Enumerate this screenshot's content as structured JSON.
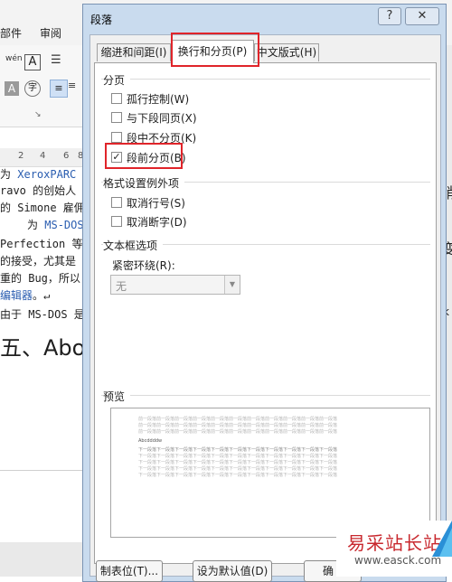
{
  "background": {
    "ribbon": {
      "tab_partial": "部件",
      "tab_review": "审阅",
      "phonetic_icon_text": "wén",
      "char_border_icon_text": "A",
      "shade_icon_text": "A",
      "circle_char_text": "字"
    },
    "ruler_ticks": [
      "2",
      "4",
      "6",
      "8"
    ],
    "doc_lines": {
      "l1_prefix": "为",
      "l1_link": "XeroxPARC",
      "l2": "ravo 的创始人",
      "l3": "的 Simone 雇佣",
      "l4_prefix": "为",
      "l4_link": "MS-DOS",
      "l5": "Perfection 等",
      "l6": "的接受，尤其是",
      "l7": "重的 Bug，所以",
      "l8_link": "编辑器",
      "l8_suffix": "。↵",
      "l9": "由于 MS-DOS 是"
    },
    "heading": "五、Abo",
    "right_chars": [
      "稍",
      "变",
      "k"
    ]
  },
  "dialog": {
    "title": "段落",
    "help_button": "?",
    "close_button": "✕",
    "tabs": [
      {
        "label": "缩进和间距(I)",
        "active": false
      },
      {
        "label": "换行和分页(P)",
        "active": true
      },
      {
        "label": "中文版式(H)",
        "active": false
      }
    ],
    "pagination": {
      "group_label": "分页",
      "options": [
        {
          "label": "孤行控制(W)",
          "checked": false
        },
        {
          "label": "与下段同页(X)",
          "checked": false
        },
        {
          "label": "段中不分页(K)",
          "checked": false
        },
        {
          "label": "段前分页(B)",
          "checked": true
        }
      ]
    },
    "format_exceptions": {
      "group_label": "格式设置例外项",
      "options": [
        {
          "label": "取消行号(S)",
          "checked": false
        },
        {
          "label": "取消断字(D)",
          "checked": false
        }
      ]
    },
    "textbox": {
      "group_label": "文本框选项",
      "tight_wrap_label": "紧密环绕(R):",
      "tight_wrap_value": "无"
    },
    "preview": {
      "label": "预览",
      "prev_text": "前一段落前一段落前一段落前一段落前一段落前一段落前一段落前一段落前一段落前一段落前一段落",
      "sample_text": "Abcddddw",
      "next_text": "下一段落下一段落下一段落下一段落下一段落下一段落下一段落下一段落下一段落下一段落下一段落"
    },
    "buttons": {
      "tabs": "制表位(T)...",
      "set_default": "设为默认值(D)",
      "ok_partial": "确"
    }
  },
  "watermark": {
    "text": "易采站长站",
    "url": "www.easck.com"
  },
  "colors": {
    "highlight_red": "#e0242a",
    "dialog_frame": "#c9dbee",
    "link_blue": "#2a5db0"
  }
}
